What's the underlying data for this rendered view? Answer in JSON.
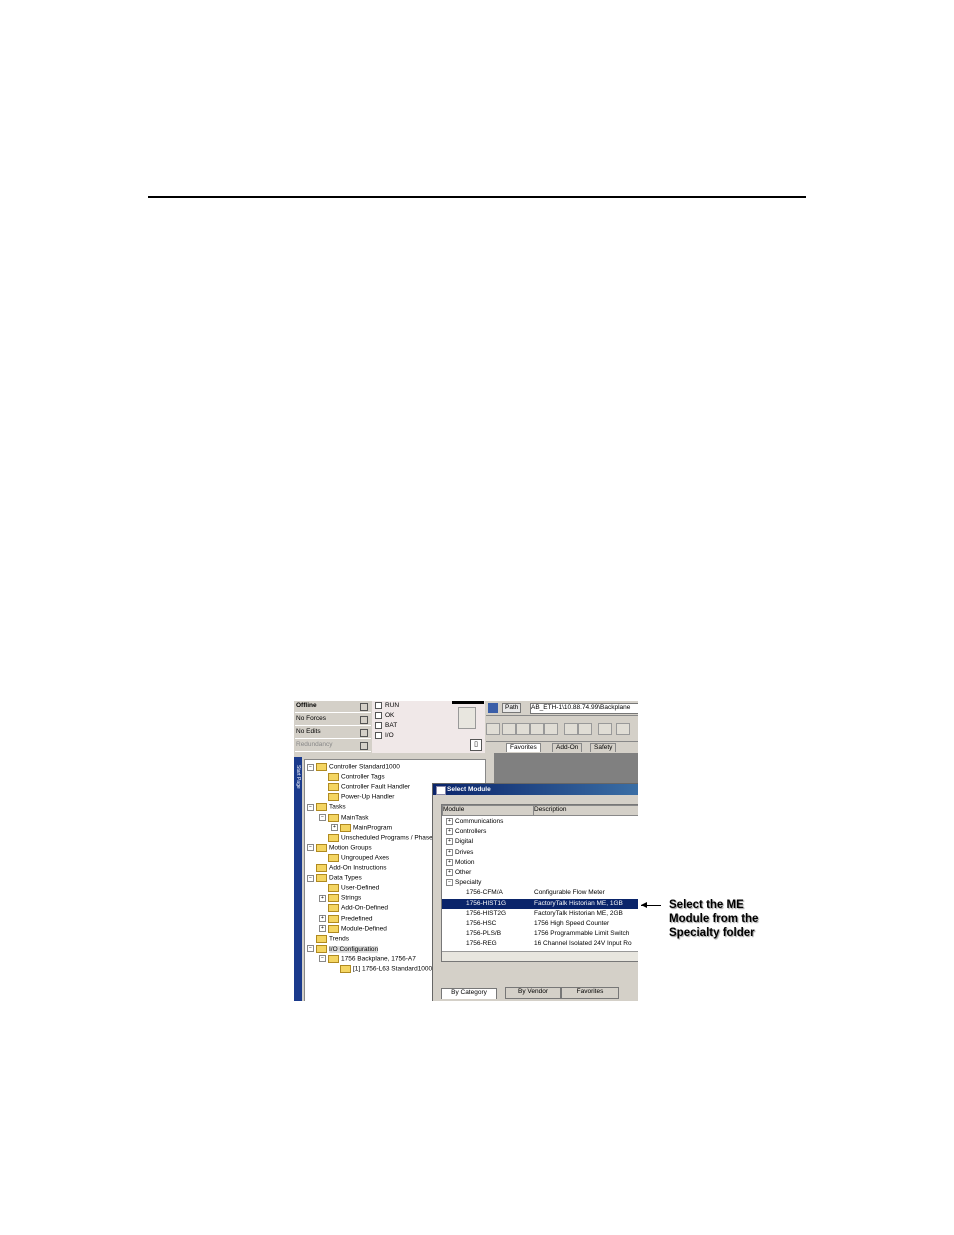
{
  "status": {
    "offline": "Offline",
    "no_forces": "No Forces",
    "no_edits": "No Edits",
    "redundancy": "Redundancy"
  },
  "leds": [
    "RUN",
    "OK",
    "BAT",
    "I/O"
  ],
  "path": {
    "label": "Path",
    "value": "AB_ETH-1\\10.88.74.99\\Backplane"
  },
  "top_tabs": [
    "Favorites",
    "Add-On",
    "Safety"
  ],
  "sidebar_label": "Start Page",
  "tree": [
    {
      "label": "Controller Standard1000",
      "depth": 0,
      "pm": "−"
    },
    {
      "label": "Controller Tags",
      "depth": 1
    },
    {
      "label": "Controller Fault Handler",
      "depth": 1
    },
    {
      "label": "Power-Up Handler",
      "depth": 1
    },
    {
      "label": "Tasks",
      "depth": 0,
      "pm": "−"
    },
    {
      "label": "MainTask",
      "depth": 1,
      "pm": "−"
    },
    {
      "label": "MainProgram",
      "depth": 2,
      "pm": "+"
    },
    {
      "label": "Unscheduled Programs / Phases",
      "depth": 1
    },
    {
      "label": "Motion Groups",
      "depth": 0,
      "pm": "−"
    },
    {
      "label": "Ungrouped Axes",
      "depth": 1
    },
    {
      "label": "Add-On Instructions",
      "depth": 0
    },
    {
      "label": "Data Types",
      "depth": 0,
      "pm": "−"
    },
    {
      "label": "User-Defined",
      "depth": 1
    },
    {
      "label": "Strings",
      "depth": 1,
      "pm": "+"
    },
    {
      "label": "Add-On-Defined",
      "depth": 1
    },
    {
      "label": "Predefined",
      "depth": 1,
      "pm": "+"
    },
    {
      "label": "Module-Defined",
      "depth": 1,
      "pm": "+"
    },
    {
      "label": "Trends",
      "depth": 0
    },
    {
      "label": "I/O Configuration",
      "depth": 0,
      "pm": "−"
    },
    {
      "label": "1756 Backplane, 1756-A7",
      "depth": 1,
      "pm": "−"
    },
    {
      "label": "[1] 1756-L63 Standard1000",
      "depth": 2
    }
  ],
  "dialog": {
    "title": "Select Module",
    "col_module": "Module",
    "col_description": "Description",
    "rows": [
      {
        "module": "Communications",
        "desc": "",
        "pm": "+"
      },
      {
        "module": "Controllers",
        "desc": "",
        "pm": "+"
      },
      {
        "module": "Digital",
        "desc": "",
        "pm": "+"
      },
      {
        "module": "Drives",
        "desc": "",
        "pm": "+"
      },
      {
        "module": "Motion",
        "desc": "",
        "pm": "+"
      },
      {
        "module": "Other",
        "desc": "",
        "pm": "+"
      },
      {
        "module": "Specialty",
        "desc": "",
        "pm": "−"
      },
      {
        "module": "1756-CFM/A",
        "desc": "Configurable Flow Meter"
      },
      {
        "module": "1756-HIST1G",
        "desc": "FactoryTalk Historian ME, 1GB",
        "selected": true
      },
      {
        "module": "1756-HIST2G",
        "desc": "FactoryTalk Historian ME, 2GB"
      },
      {
        "module": "1756-HSC",
        "desc": "1756 High Speed Counter"
      },
      {
        "module": "1756-PLS/B",
        "desc": "1756 Programmable Limit Switch"
      },
      {
        "module": "1756-REG",
        "desc": "16 Channel Isolated 24V Input Ro"
      }
    ],
    "tabs": [
      "By Category",
      "By Vendor",
      "Favorites"
    ]
  },
  "callout": "Select the ME Module from the Specialty folder"
}
